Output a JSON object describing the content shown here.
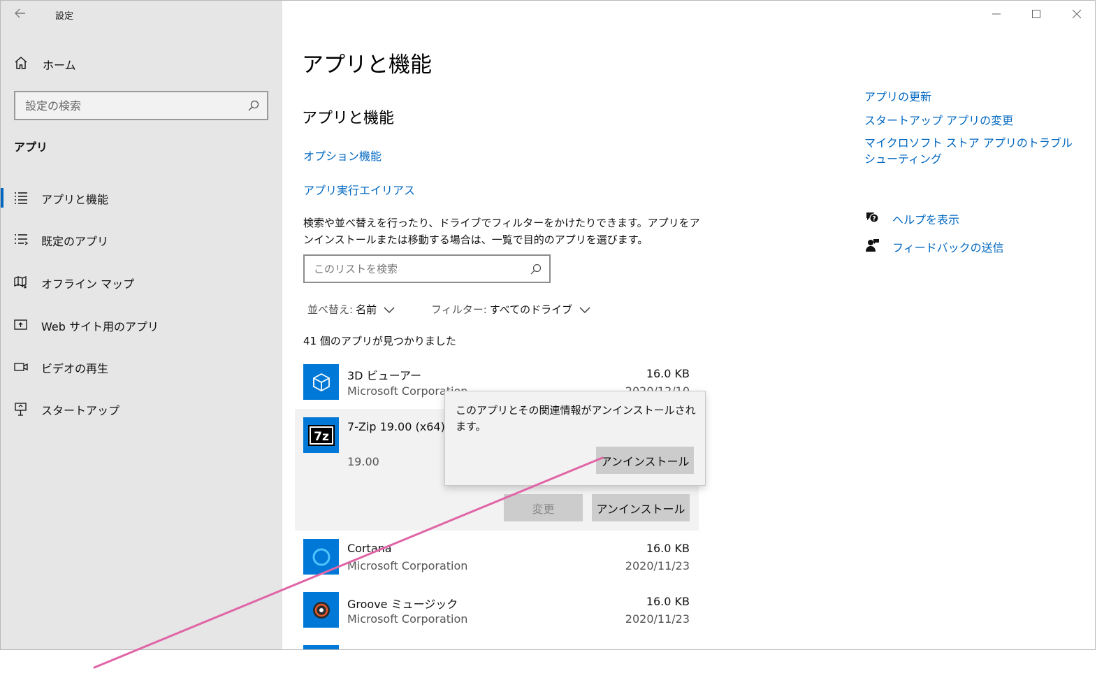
{
  "window": {
    "title": "設定"
  },
  "sidebar": {
    "home_label": "ホーム",
    "search_placeholder": "設定の検索",
    "section_label": "アプリ",
    "items": [
      {
        "label": "アプリと機能",
        "icon": "apps-features-icon",
        "active": true
      },
      {
        "label": "既定のアプリ",
        "icon": "default-apps-icon",
        "active": false
      },
      {
        "label": "オフライン マップ",
        "icon": "offline-maps-icon",
        "active": false
      },
      {
        "label": "Web サイト用のアプリ",
        "icon": "apps-for-websites-icon",
        "active": false
      },
      {
        "label": "ビデオの再生",
        "icon": "video-playback-icon",
        "active": false
      },
      {
        "label": "スタートアップ",
        "icon": "startup-icon",
        "active": false
      }
    ]
  },
  "main": {
    "page_title": "アプリと機能",
    "section_title": "アプリと機能",
    "links": {
      "optional_features": "オプション機能",
      "app_execution_aliases": "アプリ実行エイリアス"
    },
    "description": "検索や並べ替えを行ったり、ドライブでフィルターをかけたりできます。アプリをアンインストールまたは移動する場合は、一覧で目的のアプリを選びます。",
    "list_search_placeholder": "このリストを検索",
    "sort": {
      "label": "並べ替え:",
      "value": "名前"
    },
    "filter": {
      "label": "フィルター:",
      "value": "すべてのドライブ"
    },
    "count_text": "41 個のアプリが見つかりました",
    "apps": [
      {
        "name": "3D ビューアー",
        "publisher": "Microsoft Corporation",
        "size": "16.0 KB",
        "date": "2020/12/10"
      },
      {
        "name": "7-Zip 19.00 (x64)",
        "version": "19.00",
        "modify_label": "変更",
        "uninstall_label": "アンインストール"
      },
      {
        "name": "Cortana",
        "publisher": "Microsoft Corporation",
        "size": "16.0 KB",
        "date": "2020/11/23"
      },
      {
        "name": "Groove ミュージック",
        "publisher": "Microsoft Corporation",
        "size": "16.0 KB",
        "date": "2020/11/23"
      }
    ],
    "flyout": {
      "message": "このアプリとその関連情報がアンインストールされます。",
      "confirm_label": "アンインストール"
    }
  },
  "related": {
    "links": [
      "アプリの更新",
      "スタートアップ アプリの変更",
      "マイクロソフト ストア アプリのトラブルシューティング"
    ],
    "help_label": "ヘルプを表示",
    "feedback_label": "フィードバックの送信"
  },
  "colors": {
    "accent": "#0067c0",
    "tile_blue": "#0078d7",
    "annotation": "#e065a6",
    "sidebar_bg": "#e6e6e6"
  }
}
